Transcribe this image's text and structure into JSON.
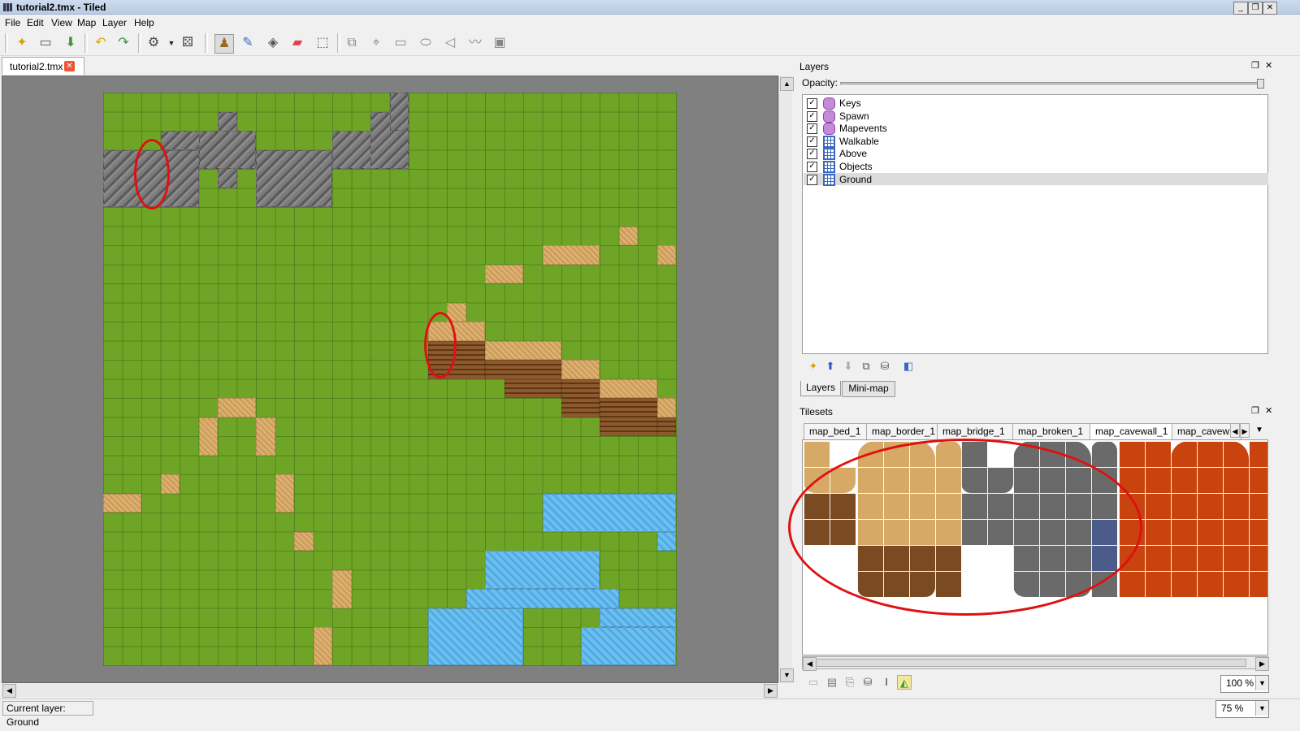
{
  "window": {
    "title": "tutorial2.tmx - Tiled"
  },
  "menu": [
    "File",
    "Edit",
    "View",
    "Map",
    "Layer",
    "Help"
  ],
  "document_tab": {
    "label": "tutorial2.tmx"
  },
  "layers_panel": {
    "title": "Layers",
    "opacity_label": "Opacity:",
    "opacity": 1.0,
    "layers": [
      {
        "name": "Keys",
        "type": "object",
        "visible": true
      },
      {
        "name": "Spawn",
        "type": "object",
        "visible": true
      },
      {
        "name": "Mapevents",
        "type": "object",
        "visible": true
      },
      {
        "name": "Walkable",
        "type": "tile",
        "visible": true
      },
      {
        "name": "Above",
        "type": "tile",
        "visible": true
      },
      {
        "name": "Objects",
        "type": "tile",
        "visible": true
      },
      {
        "name": "Ground",
        "type": "tile",
        "visible": true,
        "selected": true
      }
    ],
    "tabs": [
      "Layers",
      "Mini-map"
    ]
  },
  "tilesets_panel": {
    "title": "Tilesets",
    "tabs": [
      "map_bed_1",
      "map_border_1",
      "map_bridge_1",
      "map_broken_1",
      "map_cavewall_1",
      "map_cavew"
    ],
    "zoom": "100 %"
  },
  "status": {
    "current_layer": "Current layer: Ground",
    "zoom": "75 %"
  },
  "colors": {
    "annotation": "#e01010",
    "grass": "#6ea526",
    "water": "#5fb6ec",
    "dirt": "#d7a966"
  }
}
